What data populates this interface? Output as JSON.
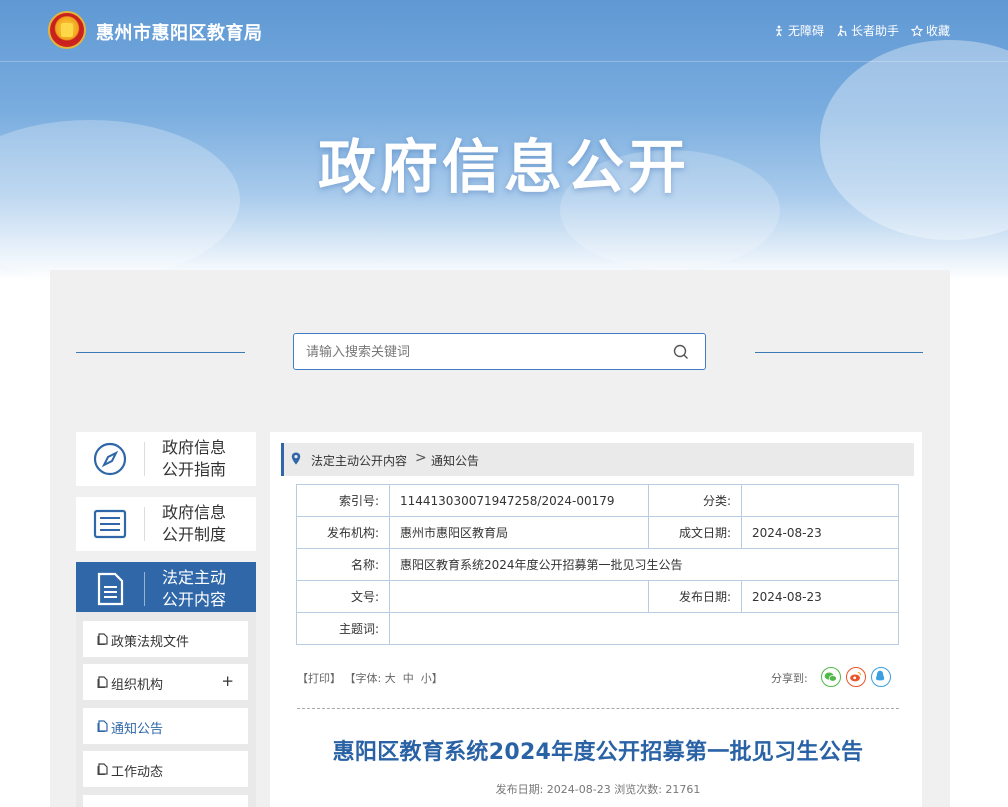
{
  "header": {
    "site_title": "惠州市惠阳区教育局",
    "links": [
      {
        "label": "无障碍",
        "icon": "accessibility-icon"
      },
      {
        "label": "长者助手",
        "icon": "elder-assist-icon"
      },
      {
        "label": "收藏",
        "icon": "star-icon"
      }
    ],
    "banner_title": "政府信息公开"
  },
  "search": {
    "placeholder": "请输入搜索关键词"
  },
  "sidebar": {
    "cards": [
      {
        "label_line1": "政府信息",
        "label_line2": "公开指南",
        "icon": "compass-icon"
      },
      {
        "label_line1": "政府信息",
        "label_line2": "公开制度",
        "icon": "list-icon"
      },
      {
        "label_line1": "法定主动",
        "label_line2": "公开内容",
        "icon": "document-icon"
      }
    ],
    "sub_items": [
      {
        "label": "政策法规文件"
      },
      {
        "label": "组织机构",
        "expand": "+"
      },
      {
        "label": "通知公告"
      },
      {
        "label": "工作动态"
      }
    ]
  },
  "breadcrumb": {
    "level1": "法定主动公开内容",
    "separator": ">",
    "level2": "通知公告"
  },
  "meta": {
    "index_label": "索引号:",
    "index_value": "114413030071947258/2024-00179",
    "category_label": "分类:",
    "category_value": "",
    "org_label": "发布机构:",
    "org_value": "惠州市惠阳区教育局",
    "written_label": "成文日期:",
    "written_value": "2024-08-23",
    "name_label": "名称:",
    "name_value": "惠阳区教育系统2024年度公开招募第一批见习生公告",
    "docno_label": "文号:",
    "docno_value": "",
    "publish_label": "发布日期:",
    "publish_value": "2024-08-23",
    "keywords_label": "主题词:",
    "keywords_value": ""
  },
  "tools": {
    "print": "【打印】",
    "font_prefix": "【字体: ",
    "font_large": "大",
    "font_medium": "中",
    "font_small": "小",
    "font_suffix": "】",
    "share_label": "分享到:"
  },
  "article": {
    "title": "惠阳区教育系统2024年度公开招募第一批见习生公告",
    "meta_line": "发布日期: 2024-08-23  浏览次数: 21761"
  },
  "colors": {
    "accent": "#2f67a8",
    "title_blue": "#2a62a6",
    "wechat": "#51b84a",
    "weibo": "#e8562a",
    "qq": "#3b9fe0"
  }
}
